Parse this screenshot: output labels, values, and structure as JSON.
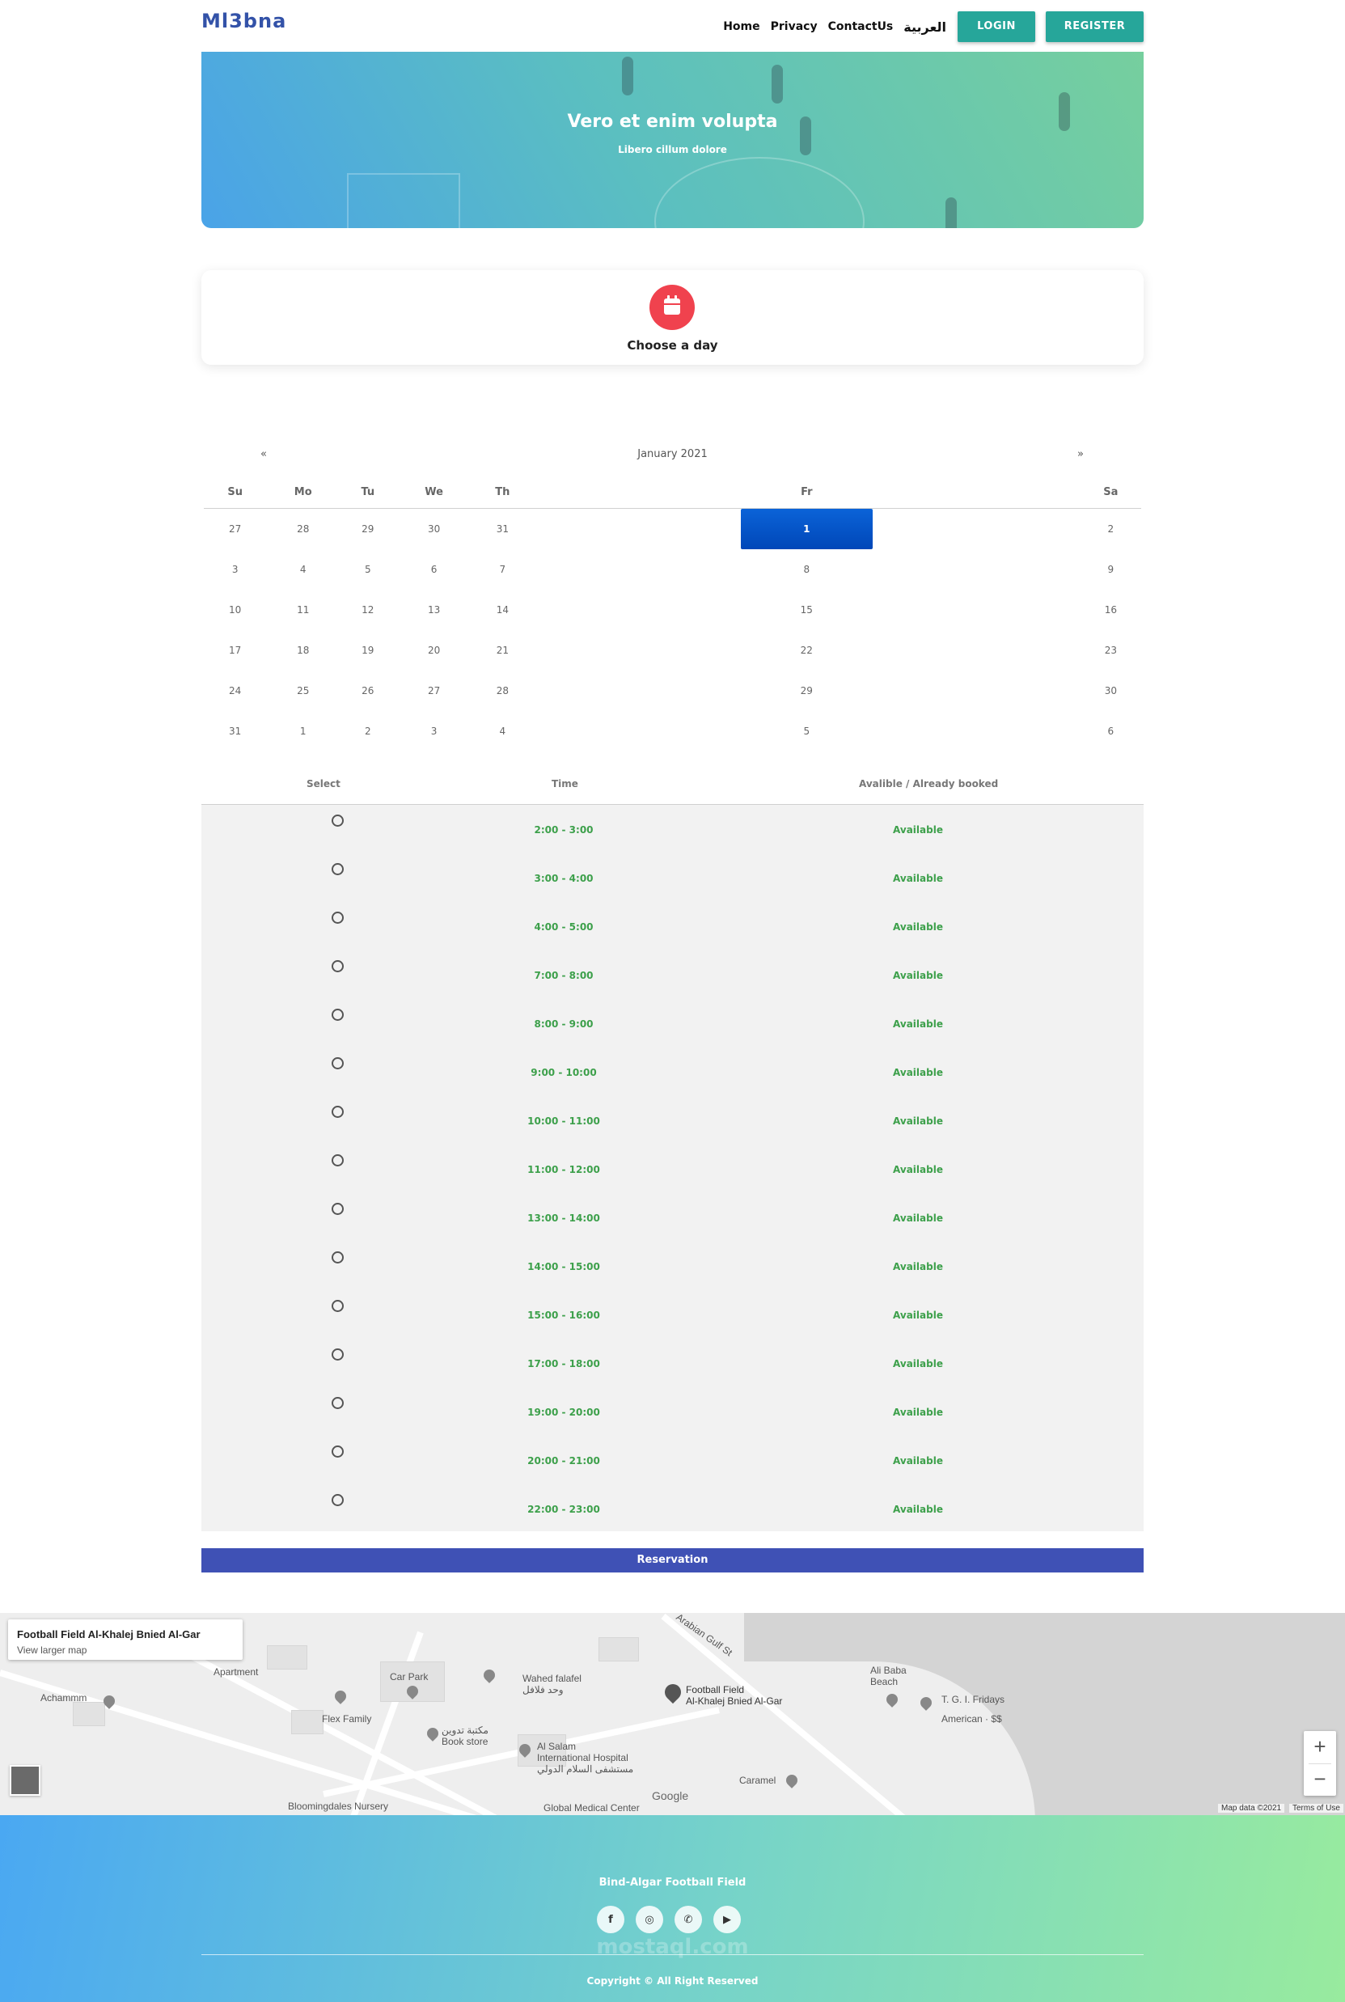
{
  "navbar": {
    "brand": "Ml3bna",
    "links": [
      "Home",
      "Privacy",
      "ContactUs",
      "العربية"
    ],
    "login_label": "LOGIN",
    "register_label": "REGISTER"
  },
  "hero": {
    "title": "Vero et enim volupta",
    "subtitle": "Libero cillum dolore"
  },
  "day_card": {
    "icon": "calendar-icon",
    "title": "Choose a day"
  },
  "calendar": {
    "prev": "«",
    "next": "»",
    "month": "January 2021",
    "weekdays": [
      "Su",
      "Mo",
      "Tu",
      "We",
      "Th",
      "Fr",
      "Sa"
    ],
    "weeks": [
      [
        "27",
        "28",
        "29",
        "30",
        "31",
        "1",
        "2"
      ],
      [
        "3",
        "4",
        "5",
        "6",
        "7",
        "8",
        "9"
      ],
      [
        "10",
        "11",
        "12",
        "13",
        "14",
        "15",
        "16"
      ],
      [
        "17",
        "18",
        "19",
        "20",
        "21",
        "22",
        "23"
      ],
      [
        "24",
        "25",
        "26",
        "27",
        "28",
        "29",
        "30"
      ],
      [
        "31",
        "1",
        "2",
        "3",
        "4",
        "5",
        "6"
      ]
    ],
    "selected_day": "1",
    "selected_color": "#0b63d8"
  },
  "slots": {
    "headers": [
      "Select",
      "Time",
      "Avalible / Already booked"
    ],
    "rows": [
      {
        "time": "2:00 - 3:00",
        "status": "Available"
      },
      {
        "time": "3:00 - 4:00",
        "status": "Available"
      },
      {
        "time": "4:00 - 5:00",
        "status": "Available"
      },
      {
        "time": "7:00 - 8:00",
        "status": "Available"
      },
      {
        "time": "8:00 - 9:00",
        "status": "Available"
      },
      {
        "time": "9:00 - 10:00",
        "status": "Available"
      },
      {
        "time": "10:00 - 11:00",
        "status": "Available"
      },
      {
        "time": "11:00 - 12:00",
        "status": "Available"
      },
      {
        "time": "13:00 - 14:00",
        "status": "Available"
      },
      {
        "time": "14:00 - 15:00",
        "status": "Available"
      },
      {
        "time": "15:00 - 16:00",
        "status": "Available"
      },
      {
        "time": "17:00 - 18:00",
        "status": "Available"
      },
      {
        "time": "19:00 - 20:00",
        "status": "Available"
      },
      {
        "time": "20:00 - 21:00",
        "status": "Available"
      },
      {
        "time": "22:00 - 23:00",
        "status": "Available"
      }
    ],
    "available_color": "#3da04b"
  },
  "reserve_label": "Reservation",
  "map": {
    "card_title": "Football Field Al-Khalej Bnied Al-Gar",
    "card_link": "View larger map",
    "labels": [
      "Football Field",
      "Al-Khalej Bnied Al-Gar",
      "Car Park",
      "Wahed falafel",
      "وحد فلافل",
      "Flex Family",
      "مكتبة تدوين",
      "Book store",
      "Al Salam",
      "International Hospital",
      "مستشفى السلام الدولي",
      "Ali Baba",
      "Beach",
      "T. G. I. Fridays",
      "American · $$",
      "Caramel",
      "Achammm",
      "Arabian Gulf St",
      "Bloomingdales Nursery",
      "Global Medical Center",
      "Apartment"
    ],
    "zoom_in": "+",
    "zoom_out": "−",
    "google": "Google",
    "map_data": "Map data ©2021",
    "terms": "Terms of Use"
  },
  "footer": {
    "title": "Bind-Algar Football Field",
    "socials": [
      {
        "icon": "facebook-icon",
        "glyph": "f"
      },
      {
        "icon": "instagram-icon",
        "glyph": "◎"
      },
      {
        "icon": "whatsapp-icon",
        "glyph": "✆"
      },
      {
        "icon": "youtube-icon",
        "glyph": "▶"
      }
    ],
    "watermark": "mostaql.com",
    "copyright": "Copyright © All Right Reserved"
  }
}
